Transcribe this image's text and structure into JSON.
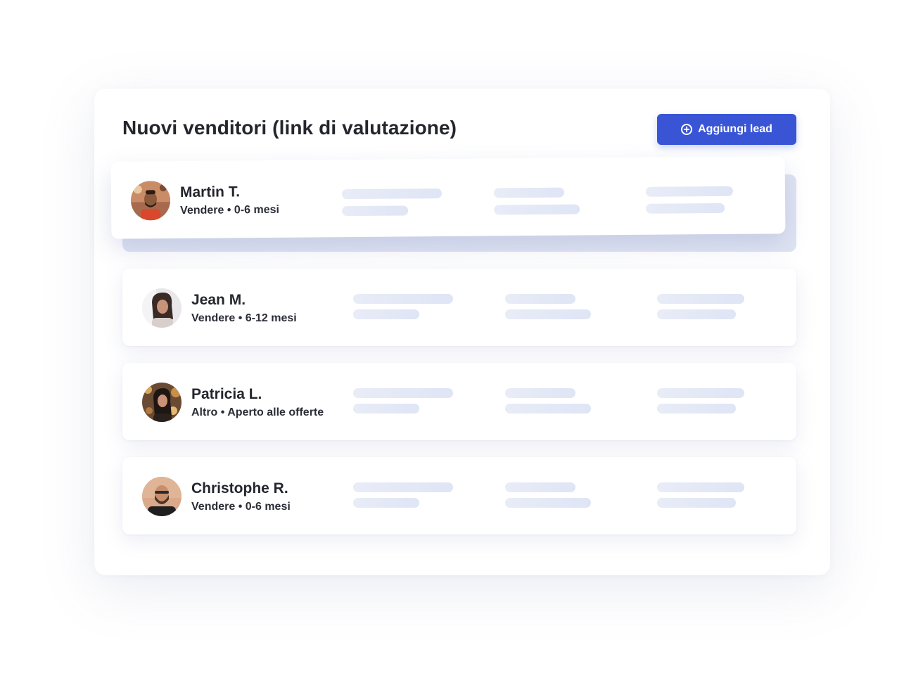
{
  "header": {
    "title": "Nuovi venditori (link di valutazione)",
    "add_button_label": "Aggiungi lead",
    "add_button_icon": "plus-circle-icon"
  },
  "colors": {
    "accent": "#3955d6",
    "skeleton": "#e3e8f6",
    "text": "#24262d"
  },
  "leads": [
    {
      "name": "Martin T.",
      "detail": "Vendere • 0-6 mesi",
      "avatar": "person-avatar"
    },
    {
      "name": "Jean M.",
      "detail": "Vendere • 6-12 mesi",
      "avatar": "person-avatar"
    },
    {
      "name": "Patricia L.",
      "detail": "Altro • Aperto alle offerte",
      "avatar": "person-avatar"
    },
    {
      "name": "Christophe R.",
      "detail": "Vendere • 0-6 mesi",
      "avatar": "person-avatar"
    }
  ]
}
